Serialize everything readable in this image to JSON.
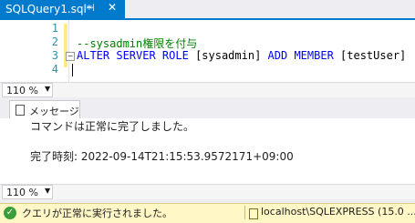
{
  "tab": {
    "title": "SQLQuery1.sql*",
    "pin_icon": "pin-icon",
    "close_icon": "close-icon"
  },
  "editor": {
    "lines": [
      {
        "num": "1",
        "text": ""
      },
      {
        "num": "2",
        "text": "--sysadmin権限を付与"
      },
      {
        "num": "3",
        "keywords": "ALTER SERVER ROLE",
        "target": "[sysadmin]",
        "keyword2": "ADD MEMBER",
        "member": "[testUser]"
      },
      {
        "num": "4",
        "text": ""
      }
    ]
  },
  "zoom_top": "110 %",
  "zoom_bottom": "110 %",
  "results": {
    "tab_label": "メッセージ",
    "line1": "コマンドは正常に完了しました。",
    "line2": "完了時刻: 2022-09-14T21:15:53.9572171+09:00"
  },
  "status": {
    "message": "クエリが正常に実行されました。",
    "server": "localhost\\SQLEXPRESS (15.0 ..."
  },
  "colors": {
    "accent": "#007acc",
    "status_bg": "#fff7c6",
    "keyword": "#0000ff",
    "comment": "#008000"
  }
}
